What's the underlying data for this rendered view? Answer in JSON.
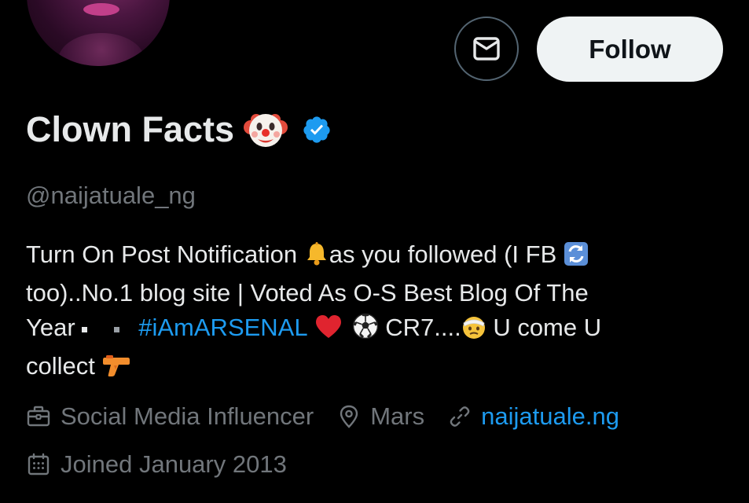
{
  "profile": {
    "display_name": "Clown Facts",
    "name_emoji": "clown-face-icon",
    "verified": true,
    "handle": "@naijatuale_ng",
    "bio": {
      "line1_a": "Turn On Post Notification ",
      "line1_b": "as you followed (I FB ",
      "line2": "too)..No.1 blog site | Voted As O-S Best Blog Of The",
      "line3_a": "Year ",
      "hashtag": "#iAmARSENAL",
      "line3_b": " CR7....",
      "line3_c": " U come U",
      "line4": "collect "
    },
    "category": "Social Media Influencer",
    "location": "Mars",
    "website": "naijatuale.ng",
    "joined": "Joined January 2013"
  },
  "actions": {
    "follow_label": "Follow",
    "message_icon": "envelope-icon"
  },
  "colors": {
    "background": "#000000",
    "text_primary": "#e7e9ea",
    "text_secondary": "#71767b",
    "accent_blue": "#1d9bf0",
    "follow_bg": "#eff3f4",
    "border": "#536471"
  },
  "icons": {
    "bio": [
      "bell-icon",
      "repeat-arrows-icon",
      "black-small-square-icon",
      "white-small-square-icon",
      "red-heart-icon",
      "soccer-ball-icon",
      "head-bandage-icon",
      "water-pistol-icon"
    ],
    "meta": [
      "briefcase-icon",
      "location-pin-icon",
      "link-icon",
      "calendar-icon"
    ]
  }
}
